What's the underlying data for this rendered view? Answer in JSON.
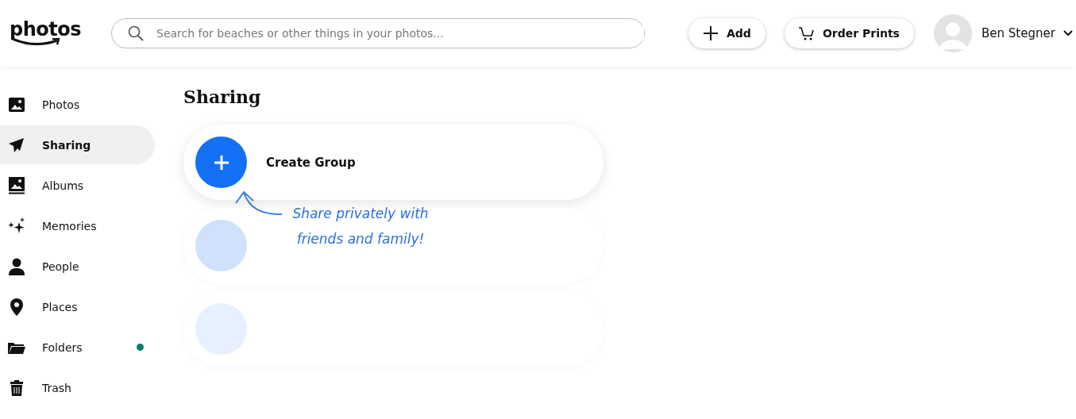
{
  "header": {
    "logo": "photos",
    "search": {
      "placeholder": "Search for beaches or other things in your photos..."
    },
    "buttons": [
      {
        "kind": "add",
        "label": "Add"
      },
      {
        "kind": "cart",
        "label": "Order Prints"
      }
    ],
    "user": {
      "name": "Ben Stegner"
    }
  },
  "sidebar": {
    "items": [
      {
        "kind": "photos",
        "label": "Photos",
        "selected": false
      },
      {
        "kind": "sharing",
        "label": "Sharing",
        "selected": true
      },
      {
        "kind": "albums",
        "label": "Albums",
        "selected": false
      },
      {
        "kind": "memories",
        "label": "Memories",
        "selected": false
      },
      {
        "kind": "people",
        "label": "People",
        "selected": false
      },
      {
        "kind": "places",
        "label": "Places",
        "selected": false
      },
      {
        "kind": "folders",
        "label": "Folders",
        "selected": false,
        "color": "#067d6f"
      },
      {
        "kind": "trash",
        "label": "Trash",
        "selected": false
      }
    ]
  },
  "main": {
    "title": "Sharing",
    "cards": [
      {
        "kind": "create",
        "label": "Create Group"
      },
      {
        "kind": "placeholder",
        "color": "#cfe1fc"
      },
      {
        "kind": "placeholder",
        "color": "#e6f0fe"
      }
    ],
    "annotation": "Share privately with friends and family!"
  }
}
